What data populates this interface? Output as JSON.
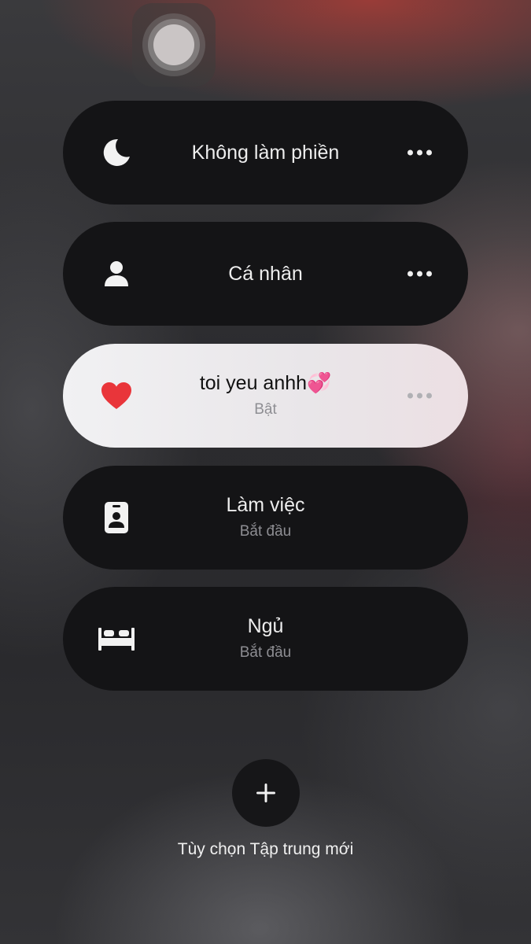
{
  "assistive_touch": {
    "icon": "assistive-touch-icon"
  },
  "focus_modes": [
    {
      "title": "Không làm phiền",
      "subtitle": "",
      "icon": "moon-icon",
      "active": false,
      "more_icon": "ellipsis-icon"
    },
    {
      "title": "Cá nhân",
      "subtitle": "",
      "icon": "person-icon",
      "active": false,
      "more_icon": "ellipsis-icon"
    },
    {
      "title": "toi yeu anhh💞",
      "subtitle": "Bật",
      "icon": "heart-icon",
      "active": true,
      "more_icon": "ellipsis-icon"
    },
    {
      "title": "Làm việc",
      "subtitle": "Bắt đầu",
      "icon": "id-badge-icon",
      "active": false
    },
    {
      "title": "Ngủ",
      "subtitle": "Bắt đầu",
      "icon": "bed-icon",
      "active": false
    }
  ],
  "new_focus": {
    "icon": "plus-icon",
    "label": "Tùy chọn Tập trung mới"
  },
  "colors": {
    "card": "#141416",
    "active_card": "#eeeef0",
    "heart": "#e9353a",
    "text": "#ededed"
  }
}
